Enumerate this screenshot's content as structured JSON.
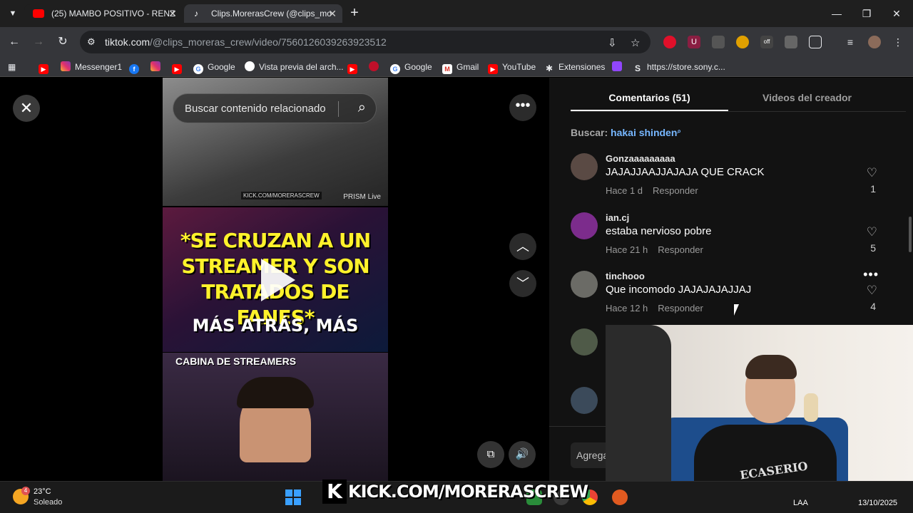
{
  "browser": {
    "tabs": [
      {
        "title": "(25) MAMBO POSITIVO - RENZ",
        "close": "✕"
      },
      {
        "title": "Clips.MorerasCrew (@clips_mo",
        "close": "✕"
      }
    ],
    "new_tab": "+",
    "window_controls": {
      "minimize": "—",
      "maximize": "❐",
      "close": "✕"
    },
    "url_host": "tiktok.com",
    "url_path": "/@clips_moreras_crew/video/7560126039263923512",
    "bookmarks": [
      {
        "label": "",
        "icon": "youtube-icon"
      },
      {
        "label": "Messenger1",
        "icon": "instagram-icon"
      },
      {
        "label": "",
        "icon": "facebook-icon"
      },
      {
        "label": "",
        "icon": "instagram-icon"
      },
      {
        "label": "",
        "icon": "youtube-icon"
      },
      {
        "label": "Google",
        "icon": "google-icon"
      },
      {
        "label": "Vista previa del arch...",
        "icon": "github-icon"
      },
      {
        "label": "",
        "icon": "youtube-icon"
      },
      {
        "label": "",
        "icon": "shield-icon"
      },
      {
        "label": "Google",
        "icon": "google-icon"
      },
      {
        "label": "Gmail",
        "icon": "gmail-icon"
      },
      {
        "label": "YouTube",
        "icon": "youtube-icon"
      },
      {
        "label": "Extensiones",
        "icon": "puzzle-icon"
      },
      {
        "label": "",
        "icon": "twitch-icon"
      },
      {
        "label": "https://store.sony.c...",
        "icon": "sony-icon"
      }
    ]
  },
  "video": {
    "search_placeholder": "Buscar contenido relacionado",
    "frame1_watermark": "PRISM Live",
    "frame1_kick": "KICK.COM/MORERASCREW",
    "overlay_lines": [
      "*SE CRUZAN A UN",
      "STREAMER Y SON",
      "TRATADOS DE",
      "FANES*"
    ],
    "overlay_sub": "MÁS ATRÁS, MÁS",
    "frame3_caption": "CABINA DE STREAMERS"
  },
  "comments_panel": {
    "tab_comments": "Comentarios (51)",
    "tab_creator": "Videos del creador",
    "search_label": "Buscar:",
    "search_term": "hakai shinden",
    "comments": [
      {
        "user": "Gonzaaaaaaaaa",
        "text": "JAJAJJAAJJAJAJA QUE CRACK",
        "time": "Hace 1 d",
        "reply": "Responder",
        "likes": "1",
        "avatar_color": "#5a4a44"
      },
      {
        "user": "ian.cj",
        "text": "estaba nervioso pobre",
        "time": "Hace 21 h",
        "reply": "Responder",
        "likes": "5",
        "avatar_color": "#7c2c8c"
      },
      {
        "user": "tinchooo",
        "text": "Que incomodo JAJAJAJAJJAJ",
        "time": "Hace 12 h",
        "reply": "Responder",
        "likes": "4",
        "avatar_color": "#6b6b66"
      }
    ],
    "add_comment_placeholder": "Agrega"
  },
  "webcam": {
    "shirt_logo": "ECASERIO"
  },
  "taskbar": {
    "temperature": "23°C",
    "weather": "Soleado",
    "weather_badge": "4",
    "stream_banner": "KICK.COM/MORERASCREW",
    "language": "LAA",
    "date": "13/10/2025"
  }
}
